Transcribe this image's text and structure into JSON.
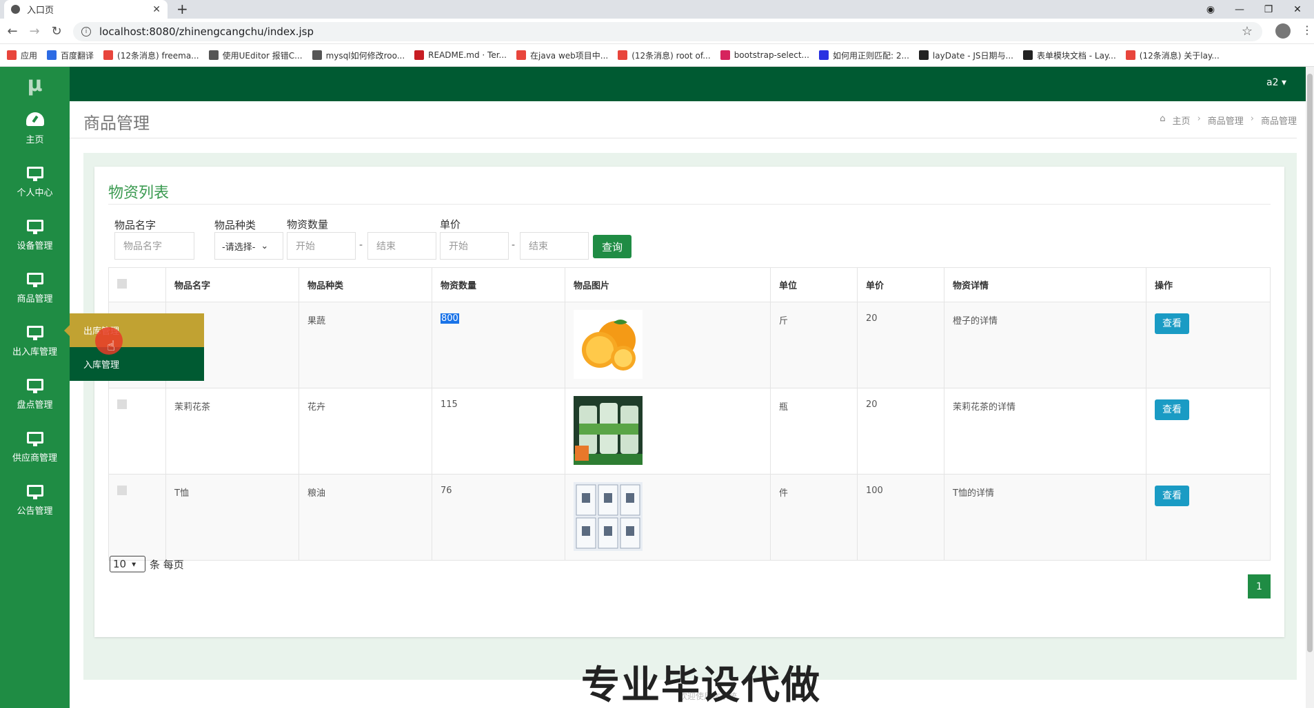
{
  "browser": {
    "tab_title": "入口页",
    "url": "localhost:8080/zhinengcangchu/index.jsp",
    "bookmarks": [
      {
        "label": "应用",
        "color": "#e8453c"
      },
      {
        "label": "百度翻译",
        "color": "#2d6be4"
      },
      {
        "label": "(12条消息) freema...",
        "color": "#e8453c"
      },
      {
        "label": "使用UEditor 报错C...",
        "color": "#555555"
      },
      {
        "label": "mysql如何修改roo...",
        "color": "#555555"
      },
      {
        "label": "README.md · Ter...",
        "color": "#c71d23"
      },
      {
        "label": "在java web项目中...",
        "color": "#e8453c"
      },
      {
        "label": "(12条消息) root of...",
        "color": "#e8453c"
      },
      {
        "label": "bootstrap-select...",
        "color": "#d6245d"
      },
      {
        "label": "如何用正则匹配: 2...",
        "color": "#2932e1"
      },
      {
        "label": "layDate - JS日期与...",
        "color": "#222222"
      },
      {
        "label": "表单模块文档 - Lay...",
        "color": "#222222"
      },
      {
        "label": "(12条消息) 关于lay...",
        "color": "#e8453c"
      }
    ]
  },
  "app": {
    "logo": "μ",
    "user": "a2 ▾",
    "sidebar": [
      {
        "label": "主页",
        "icon": "dashboard-icon"
      },
      {
        "label": "个人中心",
        "icon": "monitor-icon"
      },
      {
        "label": "设备管理",
        "icon": "monitor-icon"
      },
      {
        "label": "商品管理",
        "icon": "monitor-icon"
      },
      {
        "label": "出入库管理",
        "icon": "monitor-icon"
      },
      {
        "label": "盘点管理",
        "icon": "monitor-icon"
      },
      {
        "label": "供应商管理",
        "icon": "monitor-icon"
      },
      {
        "label": "公告管理",
        "icon": "monitor-icon"
      }
    ],
    "submenu": [
      "出库管理",
      "入库管理"
    ],
    "page_title": "商品管理",
    "breadcrumb": [
      "主页",
      "商品管理",
      "商品管理"
    ]
  },
  "card": {
    "title": "物资列表",
    "filters": {
      "name_label": "物品名字",
      "name_placeholder": "物品名字",
      "type_label": "物品种类",
      "type_value": "-请选择-",
      "qty_label": "物资数量",
      "qty_start": "开始",
      "qty_end": "结束",
      "price_label": "单价",
      "price_start": "开始",
      "price_end": "结束",
      "dash": "-",
      "query_button": "查询"
    },
    "columns": [
      "物品名字",
      "物品种类",
      "物资数量",
      "物品图片",
      "单位",
      "单价",
      "物资详情",
      "操作"
    ],
    "rows": [
      {
        "name": "",
        "type": "果蔬",
        "qty": "800",
        "image": "orange",
        "unit": "斤",
        "price": "20",
        "detail": "橙子的详情",
        "action": "查看"
      },
      {
        "name": "茉莉花茶",
        "type": "花卉",
        "qty": "115",
        "image": "jasmine-tea",
        "unit": "瓶",
        "price": "20",
        "detail": "茉莉花茶的详情",
        "action": "查看"
      },
      {
        "name": "T恤",
        "type": "粮油",
        "qty": "76",
        "image": "t-shirt",
        "unit": "件",
        "price": "100",
        "detail": "T恤的详情",
        "action": "查看"
      }
    ],
    "page_size": "10",
    "page_size_suffix": "条 每页",
    "current_page": "1"
  },
  "overlay_text": "专业毕设代做",
  "footer_text": "欢迎使用本系统"
}
